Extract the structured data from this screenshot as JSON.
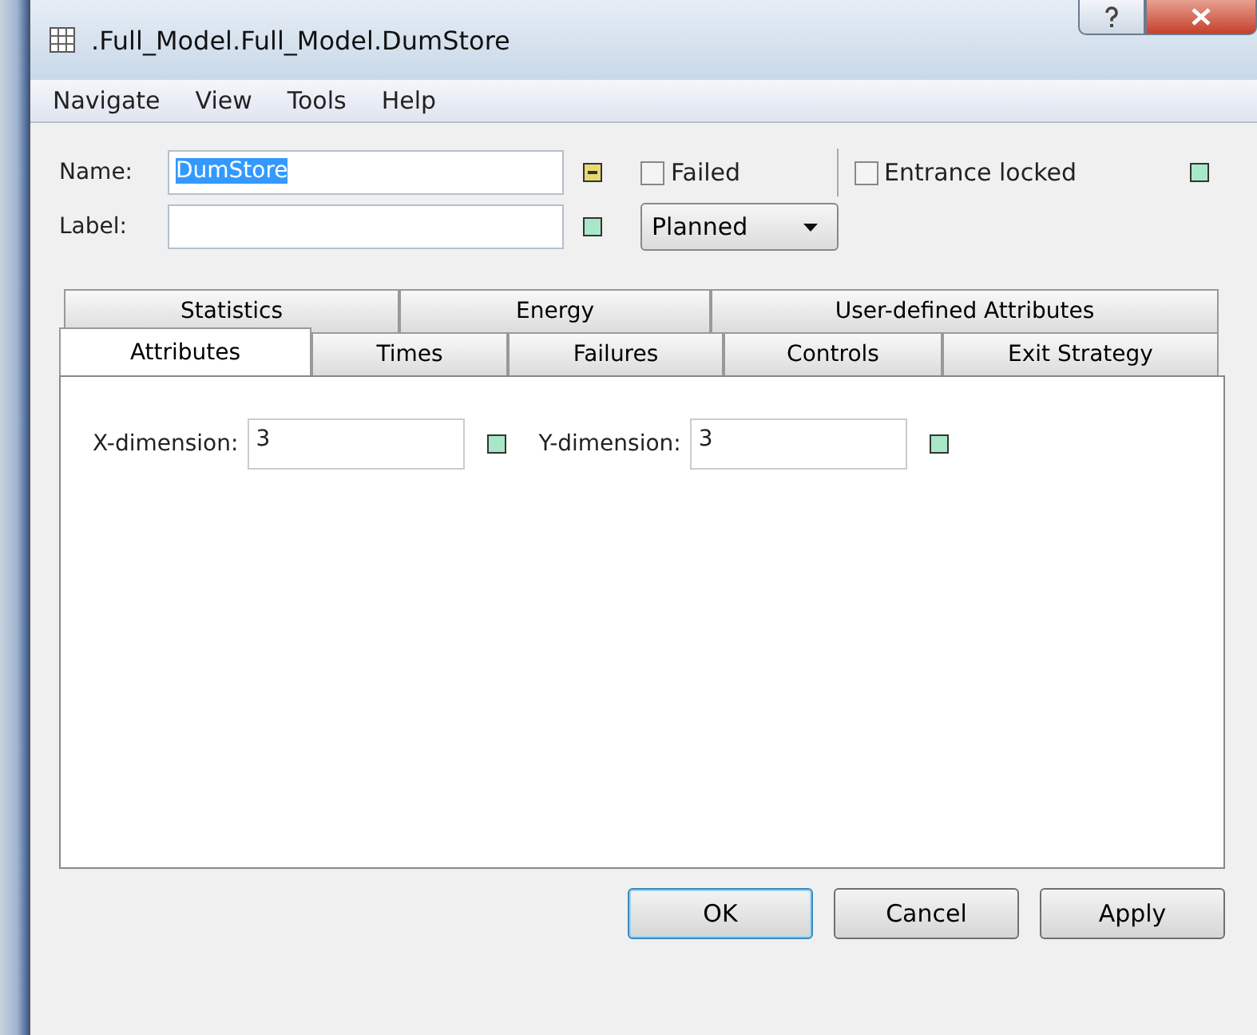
{
  "window": {
    "title": ".Full_Model.Full_Model.DumStore"
  },
  "menu": [
    "Navigate",
    "View",
    "Tools",
    "Help"
  ],
  "name_field": {
    "label": "Name:",
    "value": "DumStore",
    "selected": true,
    "indicator": {
      "color": "#e8d870",
      "kind": "dash"
    }
  },
  "label_field": {
    "label": "Label:",
    "indicator": {
      "color": "#a8e8c8",
      "kind": "plain"
    }
  },
  "failed": {
    "label": "Failed",
    "checked": false
  },
  "entrance_locked": {
    "label": "Entrance locked",
    "checked": false,
    "indicator": {
      "color": "#a8e8c8",
      "kind": "plain"
    }
  },
  "plan_dropdown": {
    "value": "Planned"
  },
  "tab_rows": [
    [
      {
        "label": "Statistics",
        "selected": false
      },
      {
        "label": "Energy",
        "selected": false
      },
      {
        "label": "User-defined Attributes",
        "selected": false
      }
    ],
    [
      {
        "label": "Attributes",
        "selected": true
      },
      {
        "label": "Times",
        "selected": false
      },
      {
        "label": "Failures",
        "selected": false
      },
      {
        "label": "Controls",
        "selected": false
      },
      {
        "label": "Exit Strategy",
        "selected": false
      }
    ]
  ],
  "attributes": [
    {
      "label": "X-dimension:",
      "value": "3",
      "indicator": {
        "color": "#a8e8c8",
        "kind": "plain"
      }
    },
    {
      "label": "Y-dimension:",
      "value": "3",
      "indicator": {
        "color": "#a8e8c8",
        "kind": "plain"
      }
    }
  ],
  "buttons": [
    {
      "label": "OK",
      "kind": "default"
    },
    {
      "label": "Cancel",
      "kind": "normal"
    },
    {
      "label": "Apply",
      "kind": "normal"
    }
  ]
}
